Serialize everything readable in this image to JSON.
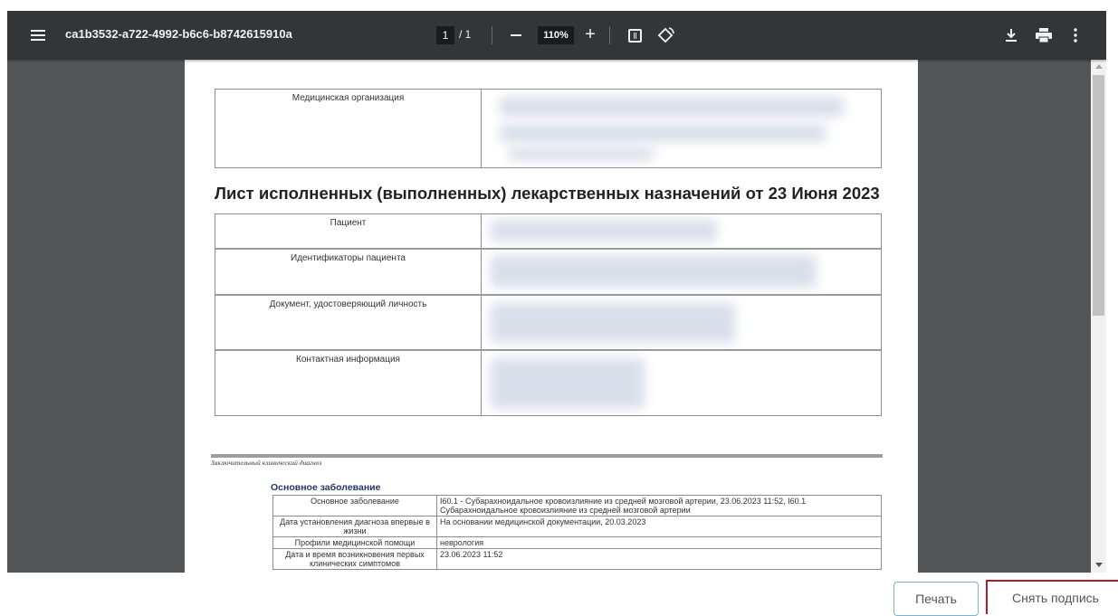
{
  "viewer": {
    "title": "ca1b3532-a722-4992-b6c6-b8742615910a",
    "page_current": "1",
    "page_total": "/ 1",
    "zoom": "110%",
    "zoom_in_symbol": "+",
    "icons": {
      "menu": "hamburger-menu-icon",
      "zoom_out": "minus-icon",
      "zoom_in": "plus-icon",
      "fit": "fit-to-page-icon",
      "rotate": "rotate-icon",
      "download": "download-icon",
      "print": "printer-icon",
      "more": "more-vertical-icon"
    },
    "colors": {
      "toolbar": "#323639",
      "background": "#525659"
    }
  },
  "document": {
    "org_label": "Медицинская организация",
    "heading": "Лист исполненных (выполненных) лекарственных назначений от 23 Июня 2023",
    "patient_rows": [
      {
        "label": "Пациент"
      },
      {
        "label": "Идентификаторы пациента"
      },
      {
        "label": "Документ, удостоверяющий личность"
      },
      {
        "label": "Контактная информация"
      }
    ],
    "diagnosis_caption": "Заключительный клинический диагноз",
    "diagnosis_title": "Основное заболевание",
    "diagnosis_rows": [
      {
        "key": "Основное заболевание",
        "value": "I60.1 - Субарахноидальное кровоизлияние из средней мозговой артерии, 23.06.2023 11:52, I60.1 Субарахноидальное кровоизлияние из средней мозговой артерии"
      },
      {
        "key": "Дата установления диагноза впервые в жизни",
        "value": "На основании медицинской документации, 20.03.2023"
      },
      {
        "key": "Профили медицинской помощи",
        "value": "неврология"
      },
      {
        "key": "Дата и время возникновения первых клинических симптомов",
        "value": "23.06.2023 11:52"
      }
    ]
  },
  "actions": {
    "print_label": "Печать",
    "unsign_label": "Снять подпись",
    "unsign_border_color": "#b01c2e"
  }
}
